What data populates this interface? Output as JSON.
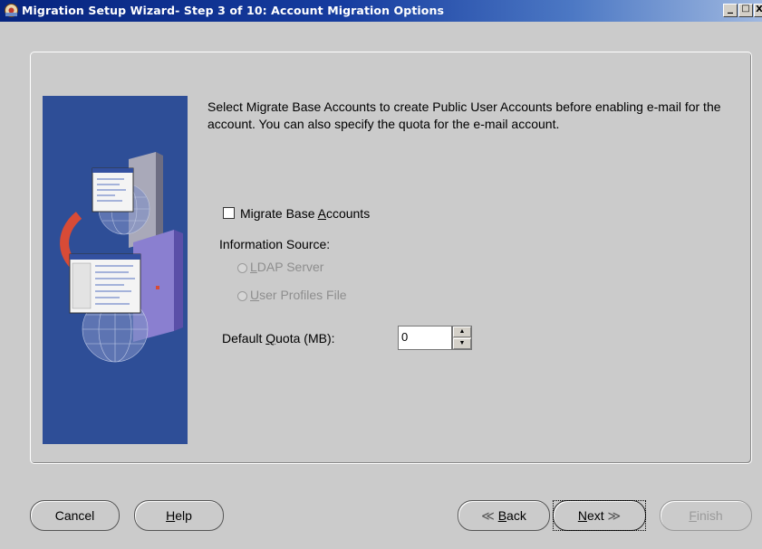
{
  "window": {
    "title": "Migration Setup Wizard-  Step 3 of 10: Account Migration Options",
    "controls": {
      "minimize": "_",
      "maximize": "□",
      "close": "X"
    }
  },
  "content": {
    "description": "Select Migrate Base Accounts to create Public User Accounts before enabling e-mail for the account. You can also specify the quota for the e-mail account.",
    "migrate_base_accounts": {
      "label_pre": "Migrate Base ",
      "label_key": "A",
      "label_post": "ccounts",
      "checked": false
    },
    "information_source": {
      "label": "Information Source:",
      "ldap": {
        "label_key": "L",
        "label_post": "DAP Server",
        "selected": false,
        "enabled": false
      },
      "user_profiles": {
        "label_key": "U",
        "label_post": "ser Profiles File",
        "selected": false,
        "enabled": false
      }
    },
    "default_quota": {
      "label_pre": "Default ",
      "label_key": "Q",
      "label_post": "uota (MB):",
      "value": "0"
    }
  },
  "buttons": {
    "cancel": "Cancel",
    "help": {
      "key": "H",
      "post": "elp"
    },
    "back": {
      "arrow": "≪",
      "key": "B",
      "post": "ack"
    },
    "next": {
      "key": "N",
      "post": "ext",
      "arrow": "≫"
    },
    "finish": {
      "key": "F",
      "post": "inish",
      "enabled": false
    }
  },
  "colors": {
    "titlebar_start": "#07257f",
    "panel_bg": "#cbcbcb",
    "art_blue": "#2e4e97"
  }
}
